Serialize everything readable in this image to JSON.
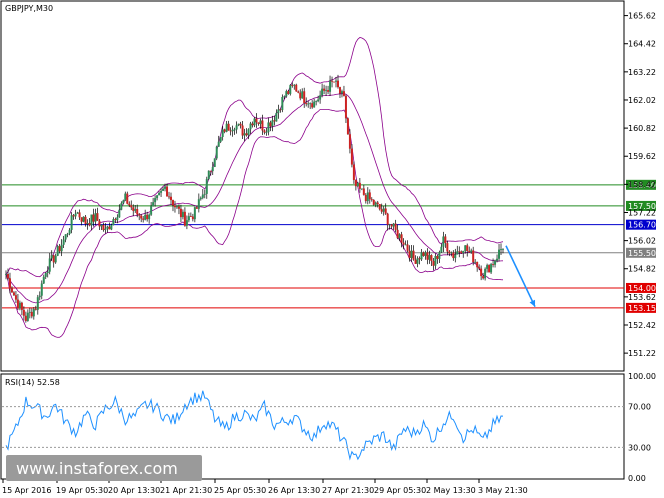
{
  "chart_data": {
    "type": "candlestick",
    "title": "GBPJPY,M30",
    "y_ticks": [
      "165.62",
      "164.42",
      "163.22",
      "162.02",
      "160.82",
      "159.62",
      "158.42",
      "157.22",
      "156.02",
      "154.82",
      "153.62",
      "152.42",
      "151.22"
    ],
    "ylim": [
      150.5,
      166.2
    ],
    "x_ticks": [
      "15 Apr 2016",
      "19 Apr 05:30",
      "20 Apr 13:30",
      "21 Apr 21:30",
      "25 Apr 05:30",
      "26 Apr 13:30",
      "27 Apr 21:30",
      "29 Apr 05:30",
      "2 May 13:30",
      "3 May 21:30"
    ],
    "levels": [
      {
        "label": "158.40",
        "value": 158.4,
        "color": "#228B22"
      },
      {
        "label": "157.50",
        "value": 157.5,
        "color": "#228B22"
      },
      {
        "label": "156.70",
        "value": 156.7,
        "color": "#0000CD"
      },
      {
        "label": "155.50",
        "value": 155.5,
        "color": "#808080"
      },
      {
        "label": "154.00",
        "value": 154.0,
        "color": "#E00000"
      },
      {
        "label": "153.15",
        "value": 153.15,
        "color": "#E00000"
      }
    ],
    "price_path": [
      154.6,
      153.5,
      152.7,
      153.2,
      154.8,
      155.4,
      156.2,
      157.3,
      156.8,
      157.0,
      156.4,
      157.1,
      157.8,
      157.2,
      157.0,
      157.6,
      158.3,
      157.5,
      156.9,
      157.2,
      158.2,
      159.7,
      160.8,
      161.0,
      160.6,
      161.3,
      160.8,
      161.3,
      162.2,
      162.6,
      162.1,
      161.9,
      162.4,
      162.8,
      162.0,
      158.4,
      158.0,
      157.6,
      157.2,
      156.5,
      156.0,
      155.2,
      155.5,
      155.0,
      156.0,
      155.4,
      155.8,
      155.3,
      154.6,
      155.1,
      155.8
    ],
    "forecast_arrow": {
      "from": 155.8,
      "to": 153.2,
      "color": "#1E90FF"
    },
    "rsi": {
      "label": "RSI(14) 52.58",
      "y_ticks": [
        "100.00",
        "70.00",
        "30.00",
        "0.00"
      ],
      "levels": [
        70,
        30
      ],
      "values": [
        30,
        48,
        75,
        70,
        60,
        72,
        55,
        45,
        62,
        52,
        68,
        75,
        58,
        60,
        72,
        70,
        60,
        56,
        72,
        79,
        80,
        58,
        48,
        60,
        63,
        56,
        70,
        52,
        55,
        60,
        48,
        40,
        55,
        50,
        35,
        18,
        30,
        38,
        42,
        28,
        48,
        44,
        52,
        38,
        55,
        62,
        40,
        48,
        36,
        52,
        60
      ]
    }
  },
  "watermark": {
    "text": "www.instaforex.com"
  }
}
